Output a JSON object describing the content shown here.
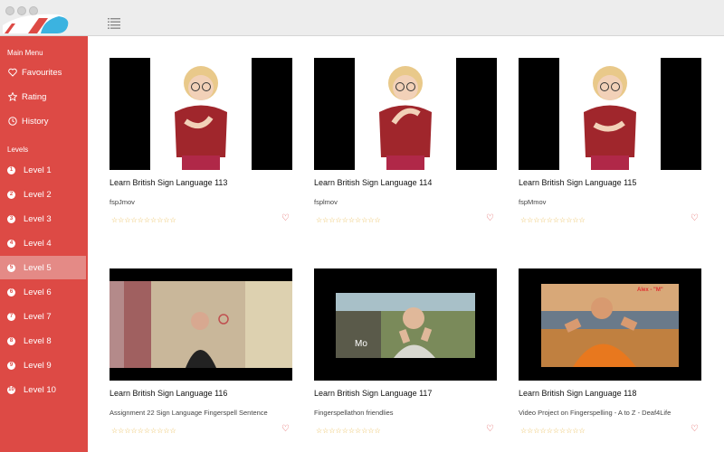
{
  "sidebar": {
    "main_menu_label": "Main Menu",
    "main_items": [
      {
        "label": "Favourites",
        "icon": "heart-icon"
      },
      {
        "label": "Rating",
        "icon": "star-icon"
      },
      {
        "label": "History",
        "icon": "clock-icon"
      }
    ],
    "levels_label": "Levels",
    "levels": [
      {
        "num": "1",
        "label": "Level 1"
      },
      {
        "num": "2",
        "label": "Level 2"
      },
      {
        "num": "3",
        "label": "Level 3"
      },
      {
        "num": "4",
        "label": "Level 4"
      },
      {
        "num": "5",
        "label": "Level 5",
        "active": true
      },
      {
        "num": "6",
        "label": "Level 6"
      },
      {
        "num": "7",
        "label": "Level 7"
      },
      {
        "num": "8",
        "label": "Level 8"
      },
      {
        "num": "9",
        "label": "Level 9"
      },
      {
        "num": "10",
        "label": "Level 10"
      }
    ]
  },
  "toolbar": {
    "icon": "list-view-icon"
  },
  "cards": [
    {
      "title": "Learn British Sign Language 113",
      "subtitle": "fspJmov",
      "stars": "☆☆☆☆☆☆☆☆☆☆",
      "favourite_icon": "heart-outline-icon",
      "thumb": "avatar"
    },
    {
      "title": "Learn British Sign Language 114",
      "subtitle": "fsplmov",
      "stars": "☆☆☆☆☆☆☆☆☆☆",
      "favourite_icon": "heart-outline-icon",
      "thumb": "avatar"
    },
    {
      "title": "Learn British Sign Language 115",
      "subtitle": "fspMmov",
      "stars": "☆☆☆☆☆☆☆☆☆☆",
      "favourite_icon": "heart-outline-icon",
      "thumb": "avatar"
    },
    {
      "title": "Learn British Sign Language 116",
      "subtitle": "Assignment 22 Sign Language Fingerspell Sentence",
      "stars": "☆☆☆☆☆☆☆☆☆☆",
      "favourite_icon": "heart-outline-icon",
      "thumb": "room"
    },
    {
      "title": "Learn British Sign Language 117",
      "subtitle": "Fingerspellathon friendlies",
      "stars": "☆☆☆☆☆☆☆☆☆☆",
      "favourite_icon": "heart-outline-icon",
      "thumb": "outdoor",
      "overlay": "Mo"
    },
    {
      "title": "Learn British Sign Language 118",
      "subtitle": "Video Project on Fingerspelling - A to Z - Deaf4Life",
      "stars": "☆☆☆☆☆☆☆☆☆☆",
      "favourite_icon": "heart-outline-icon",
      "thumb": "city",
      "overlay": "Alex - \"M\""
    }
  ],
  "colors": {
    "sidebar": "#dd4a45",
    "active_level": "#e48a86",
    "star": "#e8b84a",
    "heart": "#e05050"
  }
}
